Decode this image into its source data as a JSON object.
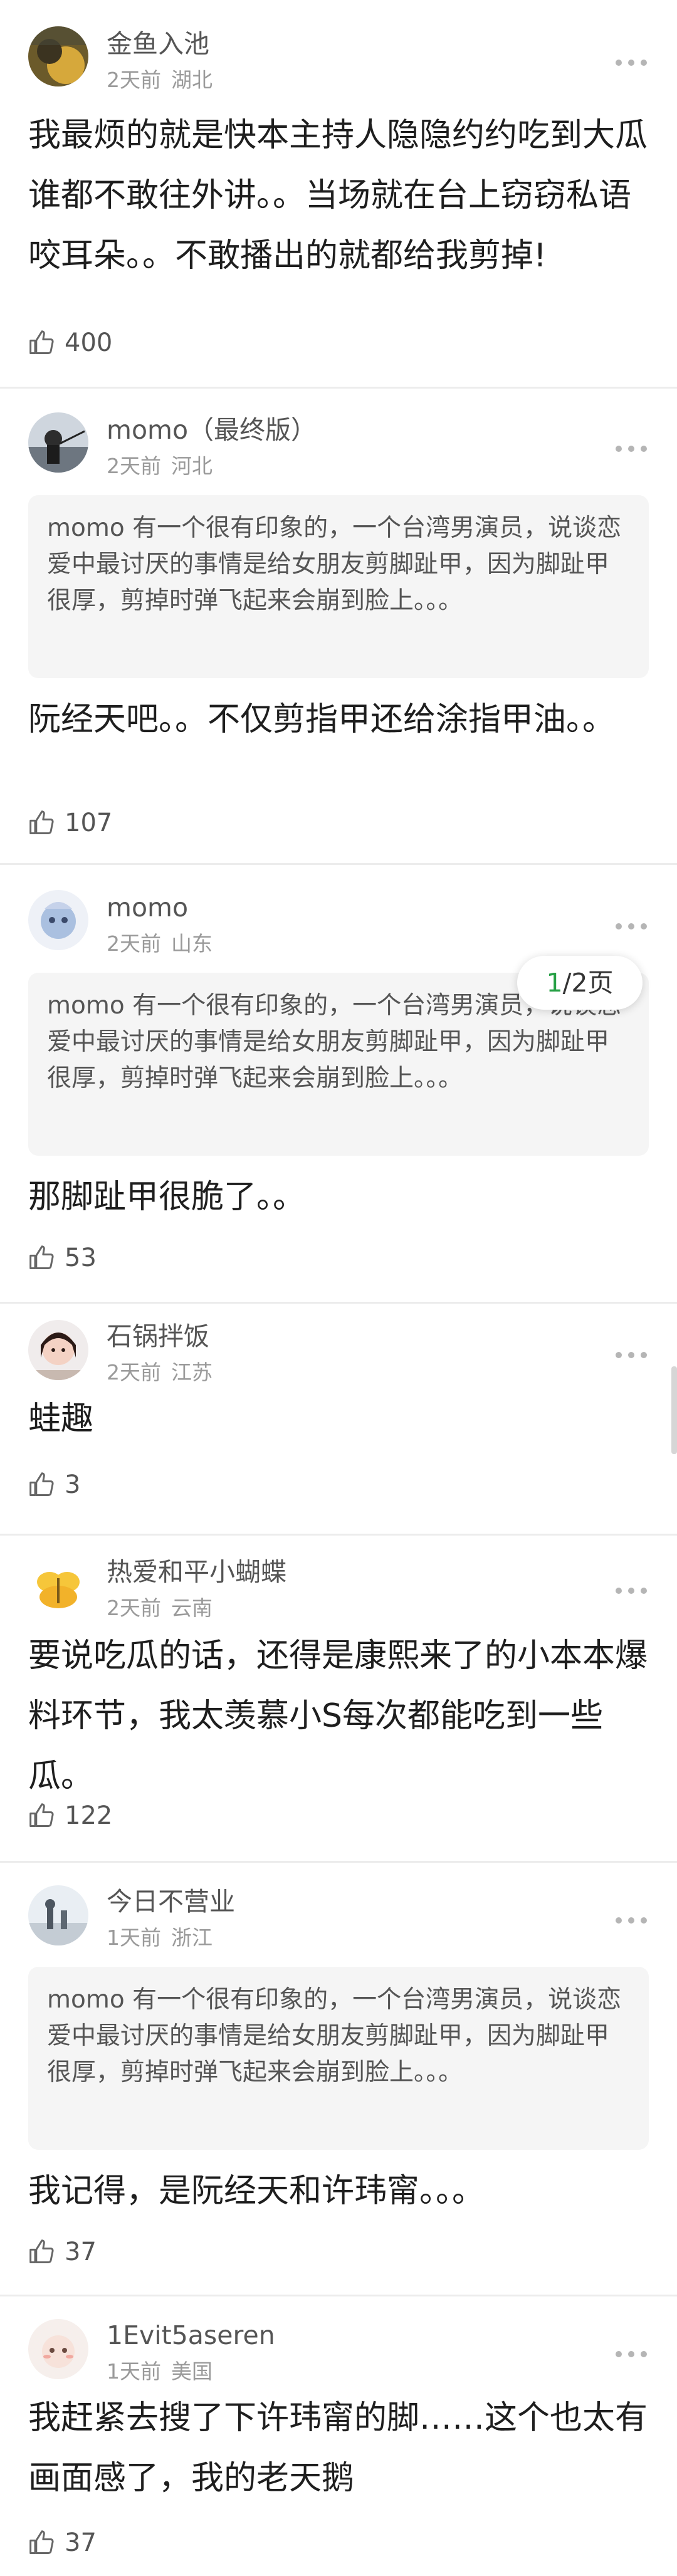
{
  "comments": [
    {
      "user": "金鱼入池",
      "time": "2天前",
      "location": "湖北",
      "text": "我最烦的就是快本主持人隐隐约约吃到大瓜谁都不敢往外讲。。当场就在台上窃窃私语咬耳朵。。不敢播出的就都给我剪掉!",
      "likes": "400"
    },
    {
      "user": "momo（最终版）",
      "time": "2天前",
      "location": "河北",
      "quote": "momo 有一个很有印象的，一个台湾男演员，说谈恋爱中最讨厌的事情是给女朋友剪脚趾甲，因为脚趾甲很厚，剪掉时弹飞起来会崩到脸上。。。",
      "text": "阮经天吧。。不仅剪指甲还给涂指甲油。。",
      "likes": "107"
    },
    {
      "user": "momo",
      "time": "2天前",
      "location": "山东",
      "quote": "momo 有一个很有印象的，一个台湾男演员，说谈恋爱中最讨厌的事情是给女朋友剪脚趾甲，因为脚趾甲很厚，剪掉时弹飞起来会崩到脸上。。。",
      "text": "那脚趾甲很脆了。。",
      "likes": "53"
    },
    {
      "user": "石锅拌饭",
      "time": "2天前",
      "location": "江苏",
      "text": "蛙趣",
      "likes": "3"
    },
    {
      "user": "热爱和平小蝴蝶",
      "time": "2天前",
      "location": "云南",
      "text": "要说吃瓜的话，还得是康熙来了的小本本爆料环节，我太羡慕小S每次都能吃到一些瓜。",
      "likes": "122"
    },
    {
      "user": "今日不营业",
      "time": "1天前",
      "location": "浙江",
      "quote": "momo 有一个很有印象的，一个台湾男演员，说谈恋爱中最讨厌的事情是给女朋友剪脚趾甲，因为脚趾甲很厚，剪掉时弹飞起来会崩到脸上。。。",
      "text": "我记得，是阮经天和许玮甯。。。",
      "likes": "37"
    },
    {
      "user": "1Evit5aseren",
      "time": "1天前",
      "location": "美国",
      "text": "我赶紧去搜了下许玮甯的脚……这个也太有画面感了，我的老天鹅",
      "likes": "37"
    }
  ],
  "page_indicator": {
    "current": "1",
    "total": "/2页"
  },
  "colors": {
    "accent_green": "#26a045",
    "meta_gray": "#9a9a9a",
    "quote_bg": "#f5f5f5"
  },
  "icons": {
    "like": "thumbs-up-icon",
    "more": "more-dots-icon"
  }
}
